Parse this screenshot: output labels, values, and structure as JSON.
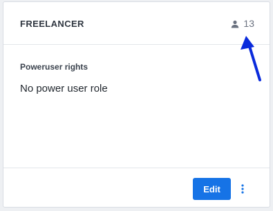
{
  "card": {
    "role_name": "FREELANCER",
    "member_count": "13",
    "member_icon": "user-icon",
    "rights_label": "Poweruser rights",
    "rights_value": "No power user role",
    "edit_label": "Edit",
    "more_icon": "more-vertical-icon"
  },
  "colors": {
    "primary": "#1673e6",
    "annotation_arrow": "#0a2bdc",
    "text_dark": "#1f252c",
    "text_muted": "#6b7280",
    "border": "#d9dde3"
  }
}
